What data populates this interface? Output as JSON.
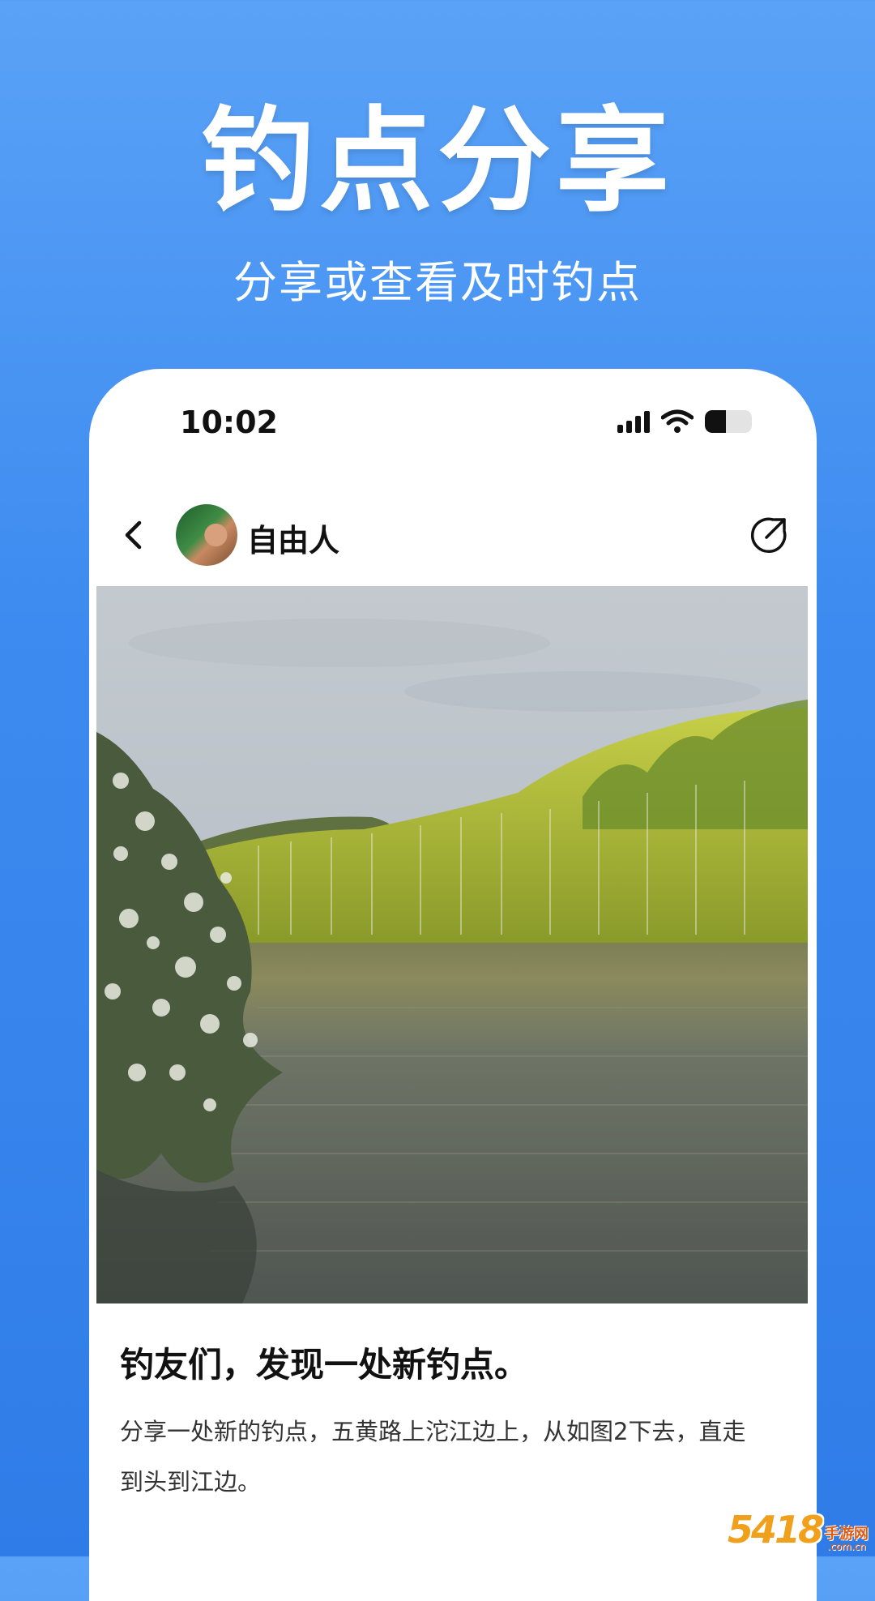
{
  "hero": {
    "title": "钓点分享",
    "subtitle": "分享或查看及时钓点"
  },
  "status_bar": {
    "time": "10:02",
    "icons": [
      "signal-icon",
      "wifi-icon",
      "battery-icon"
    ],
    "battery_level": 0.45
  },
  "nav": {
    "back_icon": "chevron-left-icon",
    "user_name": "自由人",
    "share_icon": "share-icon"
  },
  "post": {
    "title": "钓友们，发现一处新钓点。",
    "body": "分享一处新的钓点，五黄路上沱江边上，从如图2下去，直走到头到江边。"
  },
  "watermark": {
    "digits": "5418",
    "cn": "手游网",
    "en": ".com.cn"
  },
  "colors": {
    "background_top": "#5aa2f7",
    "background_bottom": "#2f7ce8",
    "card": "#ffffff",
    "text_dark": "#111111",
    "text_body": "#333333"
  }
}
